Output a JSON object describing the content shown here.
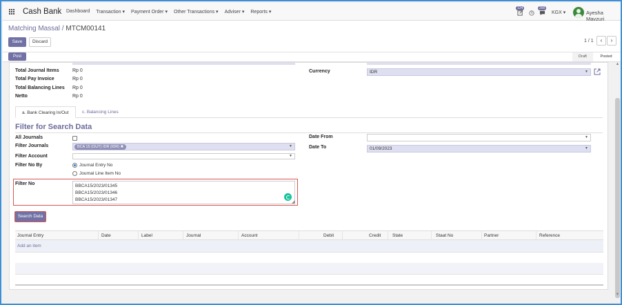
{
  "navbar": {
    "brand": "Cash Bank",
    "menu": [
      "Dashboard",
      "Transaction ▾",
      "Payment Order ▾",
      "Other Transactions ▾",
      "Adviser ▾",
      "Reports ▾"
    ],
    "activity_badge": "124",
    "messages_badge": "200",
    "company": "KGX ▾",
    "user": "Ayesha Mayzuri"
  },
  "control": {
    "breadcrumb_parent": "Matching Massal /",
    "breadcrumb_current": "MTCM00141",
    "save_label": "Save",
    "discard_label": "Discard",
    "pager": "1 / 1"
  },
  "status": {
    "post_label": "Post",
    "stages": [
      "Draft",
      "Posted"
    ],
    "current_stage": "Posted"
  },
  "summary": {
    "fields": [
      {
        "label": "Total Journal Items",
        "value": "Rp 0"
      },
      {
        "label": "Total Pay Invoice",
        "value": "Rp 0"
      },
      {
        "label": "Total Balancing Lines",
        "value": "Rp 0"
      },
      {
        "label": "Netto",
        "value": "Rp 0"
      }
    ],
    "currency_label": "Currency",
    "currency_value": "IDR"
  },
  "tabs": [
    {
      "label": "a. Bank Clearing In/Out",
      "active": true
    },
    {
      "label": "c. Balancing Lines",
      "active": false
    }
  ],
  "filter": {
    "title": "Filter for Search Data",
    "all_journals_label": "All Journals",
    "filter_journals_label": "Filter Journals",
    "filter_journals_tag": "BCA 15 (OUT) IDR (IDR) ✖",
    "filter_account_label": "Filter Account",
    "filter_no_by_label": "Filter No By",
    "radio_options": [
      "Journal Entry No",
      "Journal Line Item No"
    ],
    "radio_selected": "Journal Entry No",
    "filter_no_label": "Filter No",
    "filter_no_lines": [
      "BBCA15/2023/01345",
      "BBCA15/2023/01346",
      "BBCA15/2023/01347"
    ],
    "date_from_label": "Date From",
    "date_from_value": "",
    "date_to_label": "Date To",
    "date_to_value": "01/09/2023",
    "search_button": "Search Data"
  },
  "table": {
    "columns": [
      "Journal Entry",
      "Date",
      "Label",
      "Journal",
      "Account",
      "Debit",
      "Credit",
      "State",
      "Staat No",
      "Partner",
      "Reference"
    ],
    "add_item": "Add an item"
  },
  "colors": {
    "accent": "#7171a6",
    "highlight_border": "#d9534f",
    "frame_border": "#3d8fd6"
  }
}
